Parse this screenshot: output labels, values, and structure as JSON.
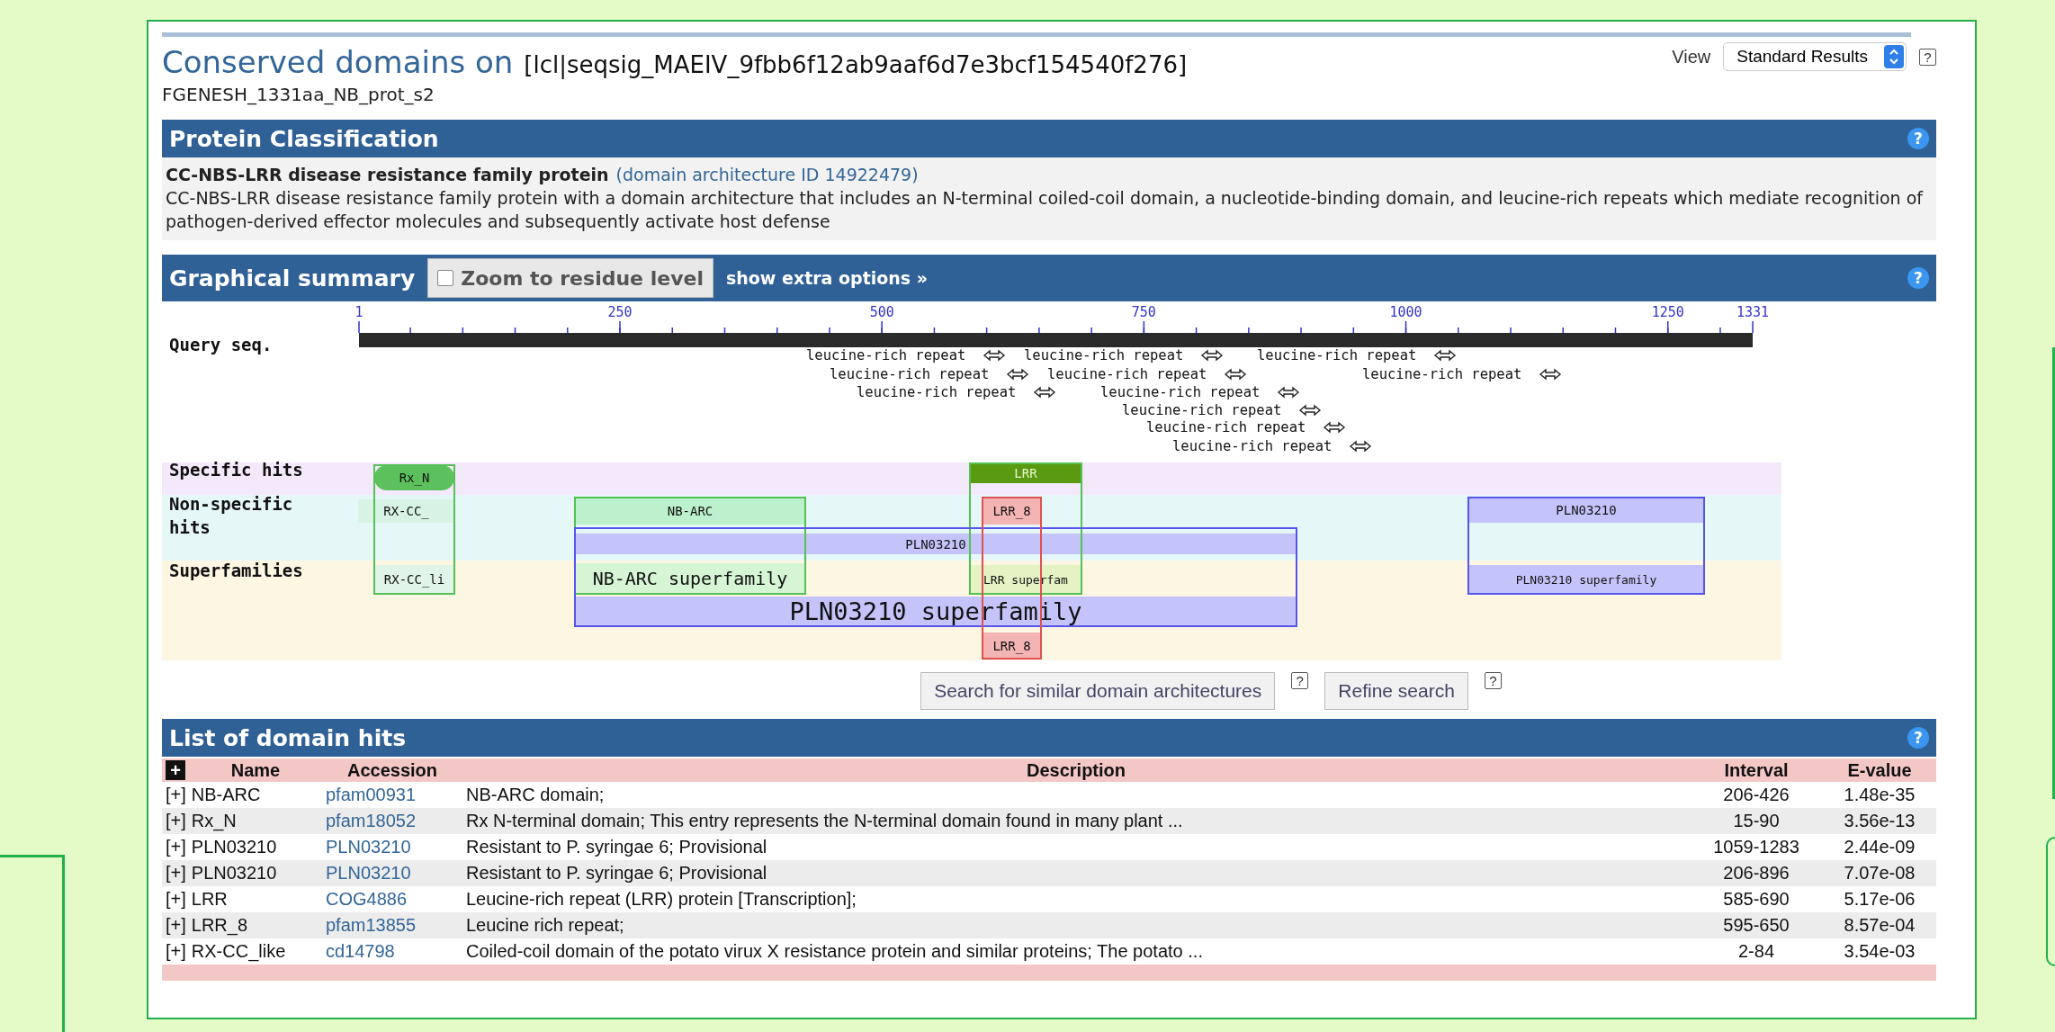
{
  "title": {
    "heading": "Conserved domains on",
    "query": "[lcl|seqsig_MAEIV_9fbb6f12ab9aaf6d7e3bcf154540f276]"
  },
  "view": {
    "label": "View",
    "value": "Standard Results",
    "help": "?"
  },
  "query_name": "FGENESH_1331aa_NB_prot_s2",
  "protein_classification": {
    "header": "Protein Classification",
    "help": "?",
    "name": "CC-NBS-LRR disease resistance family protein",
    "link": "(domain architecture ID 14922479)",
    "description": "CC-NBS-LRR disease resistance family protein with a domain architecture that includes an N-terminal coiled-coil domain, a nucleotide-binding domain, and leucine-rich repeats which mediate recognition of pathogen-derived effector molecules and subsequently activate host defense"
  },
  "graphical_summary": {
    "header": "Graphical summary",
    "help": "?",
    "zoom_checkbox": {
      "label": "Zoom to residue level",
      "checked": false
    },
    "extra_options": "show extra options »",
    "ruler": {
      "label": "Query seq.",
      "ticks": [
        "1",
        "250",
        "500",
        "750",
        "1000",
        "1250",
        "1331"
      ]
    },
    "repeats": [
      "leucine-rich repeat",
      "leucine-rich repeat",
      "leucine-rich repeat",
      "leucine-rich repeat",
      "leucine-rich repeat",
      "leucine-rich repeat",
      "leucine-rich repeat",
      "leucine-rich repeat",
      "leucine-rich repeat",
      "leucine-rich repeat",
      "leucine-rich repeat"
    ],
    "tracks": [
      {
        "label": "Specific hits"
      },
      {
        "label": "Non-specific hits"
      },
      {
        "label": "Superfamilies"
      }
    ],
    "hits": [
      {
        "label": "Rx_N",
        "color": "#5cc05c"
      },
      {
        "label": "LRR",
        "color": "#5a9a10"
      },
      {
        "label": "RX-CC_",
        "color": "#d8f3e6"
      },
      {
        "label": "NB-ARC",
        "color": "#bdf0cc"
      },
      {
        "label": "LRR_8",
        "color": "#f4b4b4"
      },
      {
        "label": "PLN03210",
        "color": "#c4c4fa"
      },
      {
        "label": "PLN03210",
        "color": "#c4c4fa"
      },
      {
        "label": "RX-CC_li",
        "color": "#e0f5e8"
      },
      {
        "label": "NB-ARC superfamily",
        "color": "#d5f5d5"
      },
      {
        "label": "LRR superfam",
        "color": "#e4f2c4"
      },
      {
        "label": "PLN03210 superfamily",
        "color": "#c4c4fa"
      },
      {
        "label": "PLN03210 superfamily",
        "color": "#c4c4fa"
      },
      {
        "label": "LRR_8",
        "color": "#f4b4b4"
      }
    ]
  },
  "buttons": [
    {
      "label": "Search for similar domain architectures",
      "help": "?"
    },
    {
      "label": "Refine search",
      "help": "?"
    }
  ],
  "domain_hits": {
    "header": "List of domain hits",
    "help": "?",
    "expand_all": "+",
    "columns": [
      "Name",
      "Accession",
      "Description",
      "Interval",
      "E-value"
    ],
    "rows": [
      {
        "toggle": "[+]",
        "name": "NB-ARC",
        "accession": "pfam00931",
        "description": "NB-ARC domain;",
        "interval": "206-426",
        "evalue": "1.48e-35"
      },
      {
        "toggle": "[+]",
        "name": "Rx_N",
        "accession": "pfam18052",
        "description": "Rx N-terminal domain; This entry represents the N-terminal domain found in many plant ...",
        "interval": "15-90",
        "evalue": "3.56e-13"
      },
      {
        "toggle": "[+]",
        "name": "PLN03210",
        "accession": "PLN03210",
        "description": "Resistant to P. syringae 6; Provisional",
        "interval": "1059-1283",
        "evalue": "2.44e-09"
      },
      {
        "toggle": "[+]",
        "name": "PLN03210",
        "accession": "PLN03210",
        "description": "Resistant to P. syringae 6; Provisional",
        "interval": "206-896",
        "evalue": "7.07e-08"
      },
      {
        "toggle": "[+]",
        "name": "LRR",
        "accession": "COG4886",
        "description": "Leucine-rich repeat (LRR) protein [Transcription];",
        "interval": "585-690",
        "evalue": "5.17e-06"
      },
      {
        "toggle": "[+]",
        "name": "LRR_8",
        "accession": "pfam13855",
        "description": "Leucine rich repeat;",
        "interval": "595-650",
        "evalue": "8.57e-04"
      },
      {
        "toggle": "[+]",
        "name": "RX-CC_like",
        "accession": "cd14798",
        "description": "Coiled-coil domain of the potato virux X resistance protein and similar proteins; The potato ...",
        "interval": "2-84",
        "evalue": "3.54e-03"
      }
    ]
  }
}
